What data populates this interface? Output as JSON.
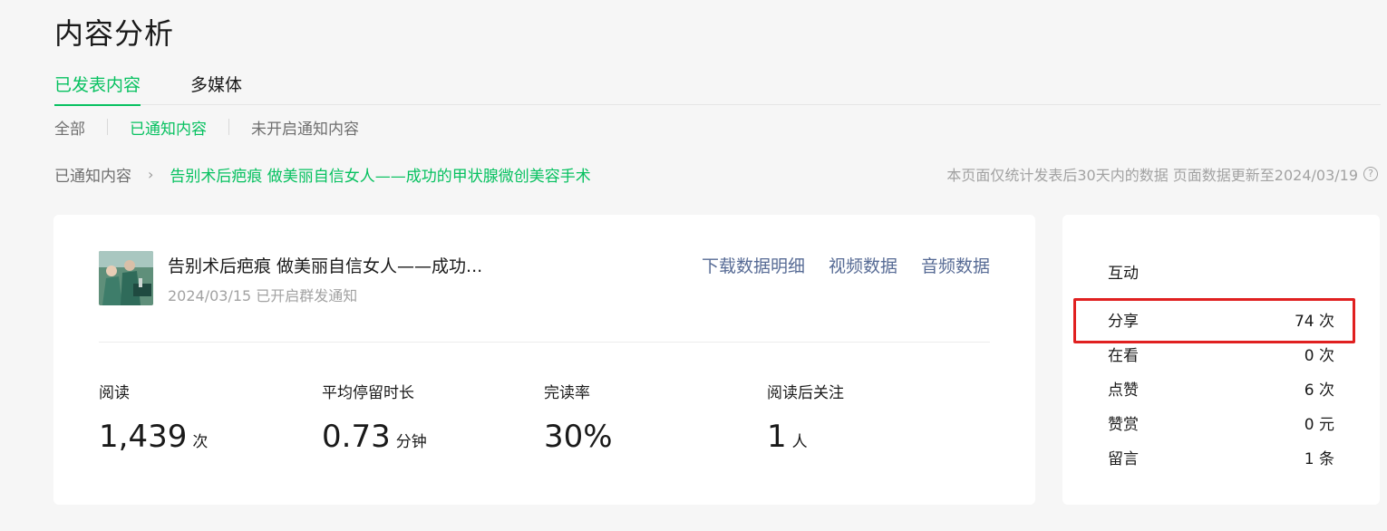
{
  "page": {
    "title": "内容分析"
  },
  "main_tabs": [
    {
      "label": "已发表内容",
      "active": true
    },
    {
      "label": "多媒体",
      "active": false
    }
  ],
  "sub_tabs": [
    {
      "label": "全部",
      "active": false
    },
    {
      "label": "已通知内容",
      "active": true
    },
    {
      "label": "未开启通知内容",
      "active": false
    }
  ],
  "breadcrumb": {
    "root": "已通知内容",
    "separator": "›",
    "current": "告别术后疤痕 做美丽自信女人——成功的甲状腺微创美容手术"
  },
  "notice": {
    "text": "本页面仅统计发表后30天内的数据 页面数据更新至2024/03/19",
    "icon": "?"
  },
  "article": {
    "title": "告别术后疤痕 做美丽自信女人——成功...",
    "meta": "2024/03/15 已开启群发通知",
    "actions": {
      "download": "下载数据明细",
      "video": "视频数据",
      "audio": "音频数据"
    }
  },
  "metrics": [
    {
      "label": "阅读",
      "value": "1,439",
      "unit": "次"
    },
    {
      "label": "平均停留时长",
      "value": "0.73",
      "unit": "分钟"
    },
    {
      "label": "完读率",
      "value": "30%",
      "unit": ""
    },
    {
      "label": "阅读后关注",
      "value": "1",
      "unit": "人"
    }
  ],
  "interaction": {
    "title": "互动",
    "rows": [
      {
        "label": "分享",
        "value": "74 次"
      },
      {
        "label": "在看",
        "value": "0 次"
      },
      {
        "label": "点赞",
        "value": "6 次"
      },
      {
        "label": "赞赏",
        "value": "0 元"
      },
      {
        "label": "留言",
        "value": "1 条"
      }
    ]
  },
  "colors": {
    "accent": "#07c160",
    "link": "#576b95",
    "highlight": "#e02020"
  }
}
